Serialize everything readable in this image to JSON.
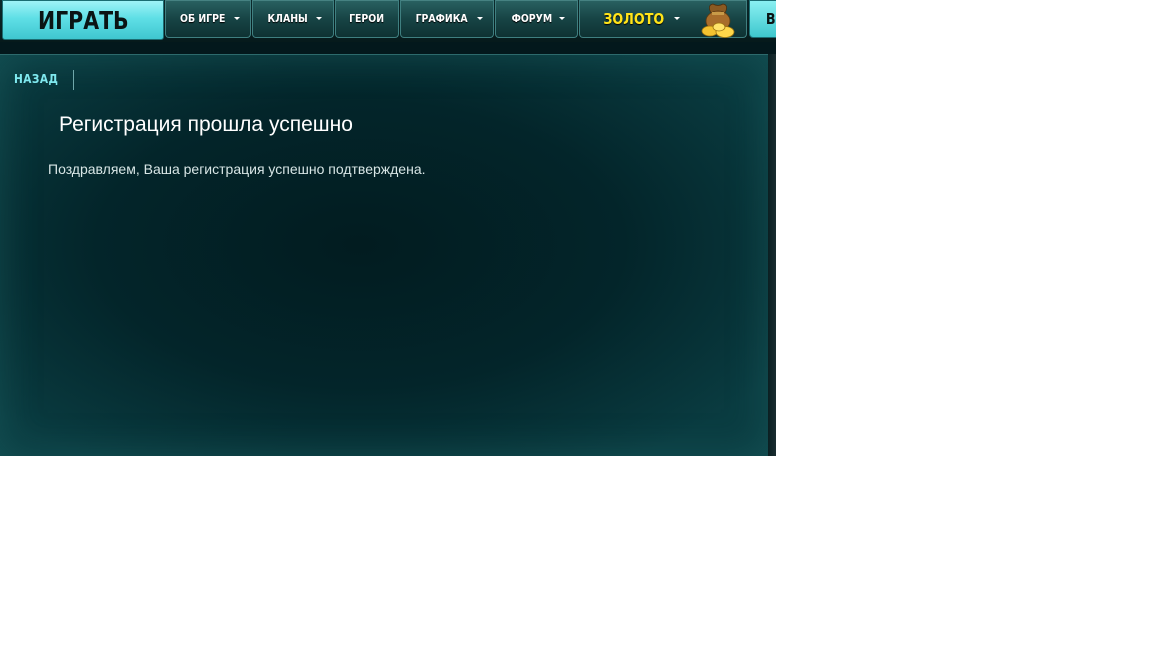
{
  "nav": {
    "play_label": "ИГРАТЬ",
    "items": [
      {
        "label": "ОБ ИГРЕ",
        "has_dropdown": true
      },
      {
        "label": "КЛАНЫ",
        "has_dropdown": true
      },
      {
        "label": "ГЕРОИ",
        "has_dropdown": false
      },
      {
        "label": "ГРАФИКА",
        "has_dropdown": true
      },
      {
        "label": "ФОРУМ",
        "has_dropdown": true
      }
    ],
    "gold_label": "ЗОЛОТО",
    "right_cut_label": "ВО"
  },
  "content": {
    "back_label": "НАЗАД",
    "title": "Регистрация прошла успешно",
    "message": "Поздравляем, Ваша регистрация успешно подтверждена."
  },
  "colors": {
    "play_button": "#5fdfe6",
    "nav_button": "#174445",
    "gold_text": "#ffe419",
    "back_link": "#7fe9ef",
    "panel_bg": "#03252a"
  }
}
